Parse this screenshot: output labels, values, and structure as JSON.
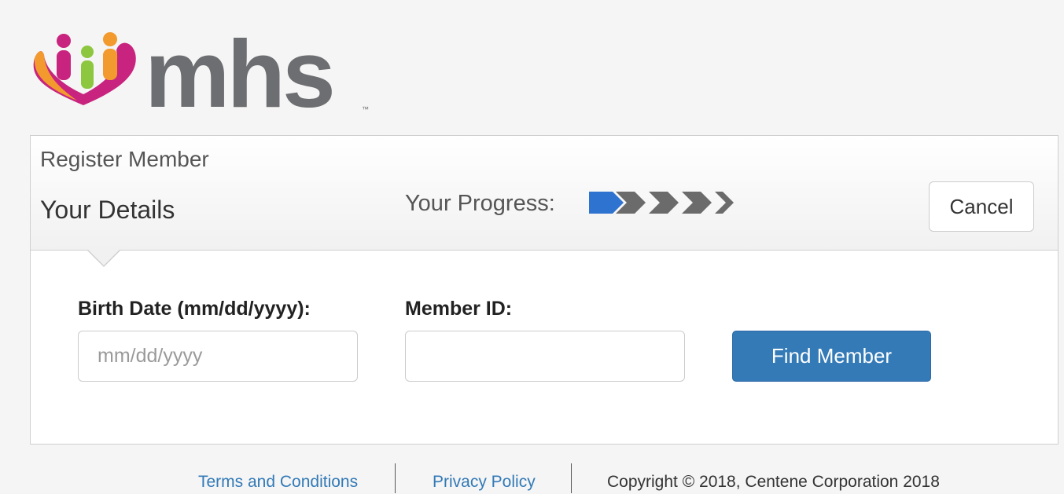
{
  "brand": {
    "logo_text": "mhs",
    "trademark": "™"
  },
  "panel": {
    "title": "Register Member",
    "step_title": "Your Details",
    "progress_label": "Your Progress:",
    "progress": {
      "current_step": 1,
      "total_steps": 5
    },
    "cancel_label": "Cancel"
  },
  "form": {
    "birth_date": {
      "label": "Birth Date (mm/dd/yyyy):",
      "placeholder": "mm/dd/yyyy",
      "value": ""
    },
    "member_id": {
      "label": "Member ID:",
      "placeholder": "",
      "value": ""
    },
    "submit_label": "Find Member"
  },
  "footer": {
    "terms_label": "Terms and Conditions",
    "privacy_label": "Privacy Policy",
    "copyright": "Copyright © 2018, Centene Corporation 2018"
  },
  "colors": {
    "primary": "#337ab7",
    "progress_active": "#2f73d0",
    "progress_inactive": "#6b6b6b",
    "logo_gray": "#6d6e71",
    "logo_magenta": "#c8237e",
    "logo_orange": "#f29a2e",
    "logo_green": "#8dc63f"
  }
}
